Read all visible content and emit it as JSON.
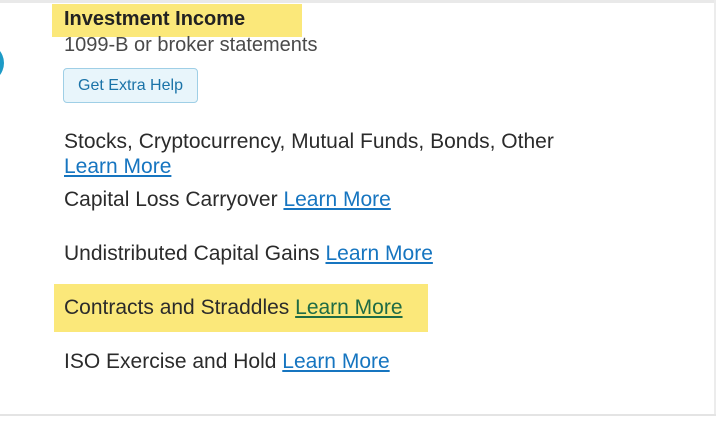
{
  "section": {
    "title": "Investment Income",
    "subtitle": "1099-B or broker statements",
    "help_button_label": "Get Extra Help",
    "icon": "investment-income-icon"
  },
  "topics": [
    {
      "label": "Stocks, Cryptocurrency, Mutual Funds, Bonds, Other",
      "link": "Learn More"
    },
    {
      "label": "Capital Loss Carryover",
      "link": "Learn More"
    },
    {
      "label": "Undistributed Capital Gains",
      "link": "Learn More"
    },
    {
      "label": "Contracts and Straddles",
      "link": "Learn More"
    },
    {
      "label": "ISO Exercise and Hold",
      "link": "Learn More"
    }
  ],
  "colors": {
    "highlight": "#fbe87a",
    "link": "#1675c0",
    "button_bg": "#e8f5fb",
    "button_border": "#9fcfe6",
    "icon_teal": "#1d9bc7"
  }
}
